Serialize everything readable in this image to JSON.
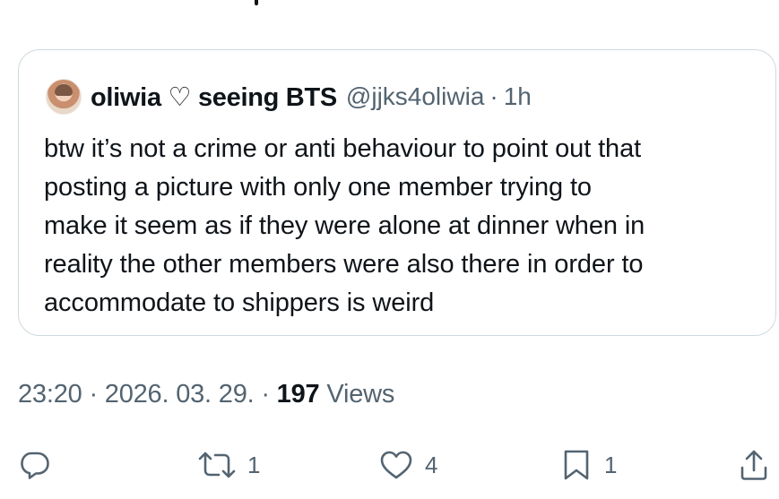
{
  "quoted_post": {
    "display_name": "oliwia ♡ seeing BTS",
    "handle": "@jjks4oliwia",
    "separator": "·",
    "age": "1h",
    "text_lines": [
      "btw it’s not a crime or anti behaviour to point out that",
      "posting a picture with only one member trying to",
      "make it seem as if they were alone at dinner when in",
      "reality the other members were also there in order to",
      "accommodate to shippers is weird"
    ]
  },
  "post_meta": {
    "time": "23:20",
    "sep1": "·",
    "date": "2026. 03. 29.",
    "sep2": "·",
    "views_count": "197",
    "views_label": "Views"
  },
  "actions": {
    "reply": {
      "icon": "reply-icon",
      "count": ""
    },
    "repost": {
      "icon": "repost-icon",
      "count": "1"
    },
    "like": {
      "icon": "heart-icon",
      "count": "4"
    },
    "bookmark": {
      "icon": "bookmark-icon",
      "count": "1"
    },
    "share": {
      "icon": "share-icon",
      "count": ""
    }
  },
  "colors": {
    "text_primary": "#0f1419",
    "text_secondary": "#536471",
    "border": "#cfd9de"
  }
}
